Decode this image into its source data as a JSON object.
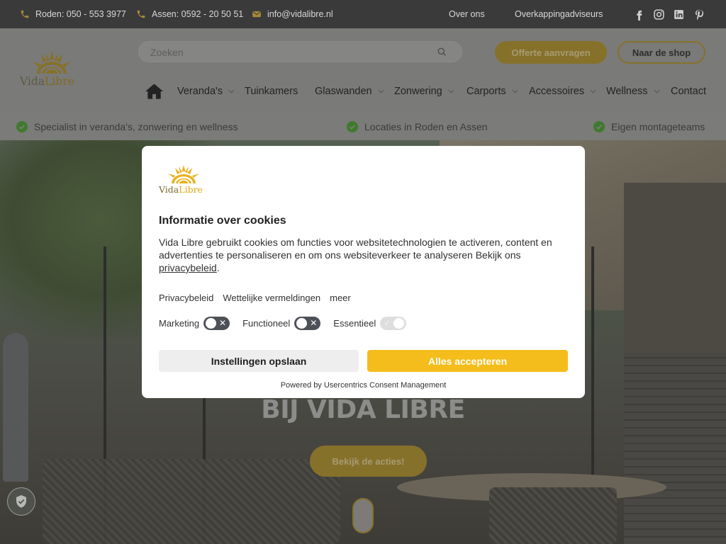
{
  "topbar": {
    "phone_roden": "Roden: 050 - 553 3977",
    "phone_assen": "Assen: 0592 - 20 50 51",
    "email": "info@vidalibre.nl",
    "links": [
      "Over ons",
      "Overkappingadviseurs"
    ],
    "social": [
      "facebook-icon",
      "instagram-icon",
      "linkedin-icon",
      "pinterest-icon"
    ]
  },
  "header": {
    "logo_part1": "Vida",
    "logo_part2": "Libre",
    "search_placeholder": "Zoeken",
    "quote_button": "Offerte aanvragen",
    "shop_button": "Naar de shop",
    "nav": [
      {
        "label": "Veranda's",
        "dropdown": true
      },
      {
        "label": "Tuinkamers",
        "dropdown": false
      },
      {
        "label": "Glaswanden",
        "dropdown": true
      },
      {
        "label": "Zonwering",
        "dropdown": true
      },
      {
        "label": "Carports",
        "dropdown": true
      },
      {
        "label": "Accessoires",
        "dropdown": true
      },
      {
        "label": "Wellness",
        "dropdown": true
      },
      {
        "label": "Contact",
        "dropdown": false
      }
    ]
  },
  "usp": [
    "Specialist in veranda's, zonwering en wellness",
    "Locaties in Roden en Assen",
    "Eigen montageteams"
  ],
  "hero": {
    "headline": "BIJ VIDA LIBRE",
    "cta": "Bekijk de acties!"
  },
  "cookie": {
    "logo_part1": "Vida",
    "logo_part2": "Libre",
    "title": "Informatie over cookies",
    "description": "Vida Libre gebruikt cookies om functies voor websitetechnologien te activeren, content en advertenties te personaliseren en om ons websiteverkeer te analyseren Bekijk ons",
    "privacy_link": "privacybeleid",
    "links": [
      "Privacybeleid",
      "Wettelijke vermeldingen",
      "meer"
    ],
    "toggles": [
      {
        "label": "Marketing",
        "state": "off"
      },
      {
        "label": "Functioneel",
        "state": "off"
      },
      {
        "label": "Essentieel",
        "state": "on-disabled"
      }
    ],
    "save_button": "Instellingen opslaan",
    "accept_button": "Alles accepteren",
    "powered_by": "Powered by Usercentrics Consent Management"
  },
  "colors": {
    "accent": "#f5bd1b",
    "topbar": "#3a3a3a",
    "toggle_off": "#4d5157",
    "check": "#3f7a2c"
  }
}
